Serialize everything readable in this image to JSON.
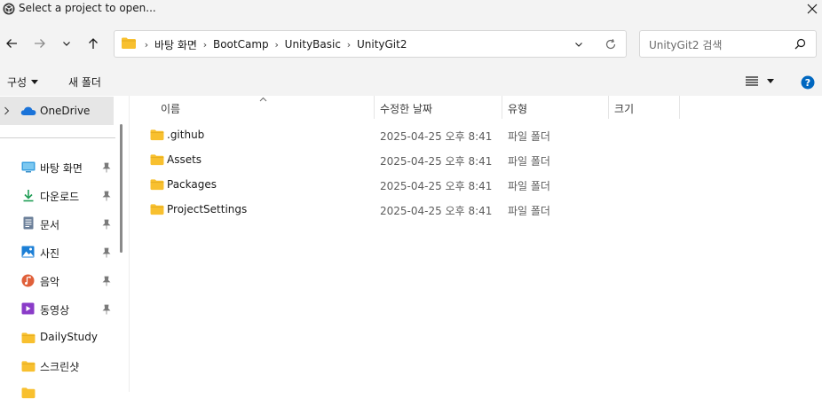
{
  "window": {
    "title": "Select a project to open..."
  },
  "nav": {
    "back_icon": "arrow-left-icon",
    "forward_icon": "arrow-right-icon",
    "recent_icon": "chevron-down-icon",
    "up_icon": "arrow-up-icon",
    "breadcrumbs": [
      "바탕 화면",
      "BootCamp",
      "UnityBasic",
      "UnityGit2"
    ],
    "refresh_icon": "refresh-icon",
    "search_placeholder": "UnityGit2 검색"
  },
  "commands": {
    "organize": "구성",
    "new_folder": "새 폴더"
  },
  "sidebar": {
    "onedrive": "OneDrive",
    "items": [
      {
        "label": "바탕 화면",
        "icon": "desktop-icon",
        "pinned": true
      },
      {
        "label": "다운로드",
        "icon": "download-icon",
        "pinned": true
      },
      {
        "label": "문서",
        "icon": "document-icon",
        "pinned": true
      },
      {
        "label": "사진",
        "icon": "picture-icon",
        "pinned": true
      },
      {
        "label": "음악",
        "icon": "music-icon",
        "pinned": true
      },
      {
        "label": "동영상",
        "icon": "video-icon",
        "pinned": true
      },
      {
        "label": "DailyStudy",
        "icon": "folder-icon",
        "pinned": false
      },
      {
        "label": "스크린샷",
        "icon": "folder-icon",
        "pinned": false
      }
    ]
  },
  "columns": {
    "name": "이름",
    "date": "수정한 날짜",
    "type": "유형",
    "size": "크기"
  },
  "files": [
    {
      "name": ".github",
      "date": "2025-04-25 오후 8:41",
      "type": "파일 폴더"
    },
    {
      "name": "Assets",
      "date": "2025-04-25 오후 8:41",
      "type": "파일 폴더"
    },
    {
      "name": "Packages",
      "date": "2025-04-25 오후 8:41",
      "type": "파일 폴더"
    },
    {
      "name": "ProjectSettings",
      "date": "2025-04-25 오후 8:41",
      "type": "파일 폴더"
    }
  ],
  "colors": {
    "chrome": "#f3f3f3",
    "folder": "#f8c02f",
    "accent": "#0067c0",
    "onedrive": "#1a73d9"
  }
}
